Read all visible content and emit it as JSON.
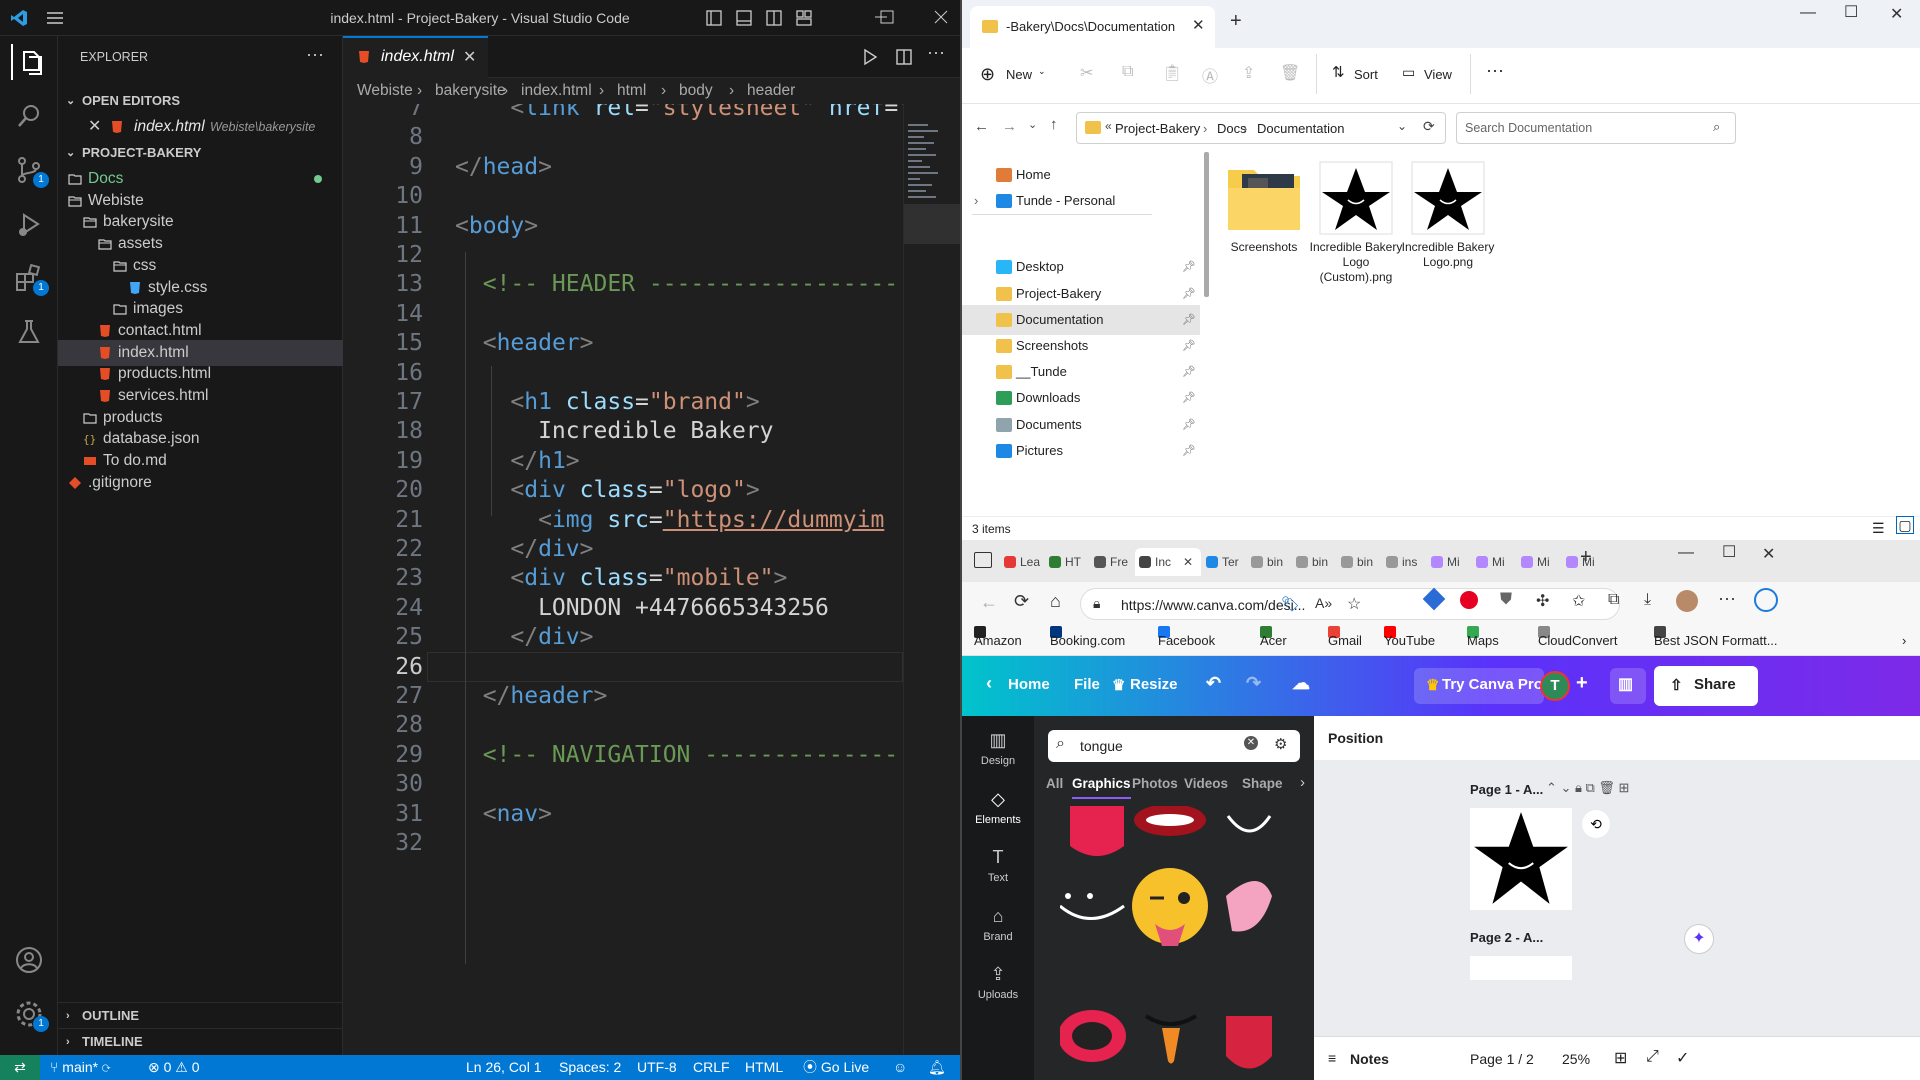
{
  "vscode": {
    "title": "index.html - Project-Bakery - Visual Studio Code",
    "explorer_label": "EXPLORER",
    "open_editors_label": "OPEN EDITORS",
    "open_editor_file": "index.html",
    "open_editor_path": "Webiste\\bakerysite",
    "project_label": "PROJECT-BAKERY",
    "tree": [
      {
        "label": "Docs",
        "kind": "folder",
        "depth": 0
      },
      {
        "label": "Webiste",
        "kind": "folder-open",
        "depth": 0
      },
      {
        "label": "bakerysite",
        "kind": "folder-open",
        "depth": 1
      },
      {
        "label": "assets",
        "kind": "folder-open",
        "depth": 2
      },
      {
        "label": "css",
        "kind": "folder-open",
        "depth": 3
      },
      {
        "label": "style.css",
        "kind": "css",
        "depth": 4
      },
      {
        "label": "images",
        "kind": "folder",
        "depth": 3
      },
      {
        "label": "contact.html",
        "kind": "html",
        "depth": 2
      },
      {
        "label": "index.html",
        "kind": "html",
        "depth": 2
      },
      {
        "label": "products.html",
        "kind": "html",
        "depth": 2
      },
      {
        "label": "services.html",
        "kind": "html",
        "depth": 2
      },
      {
        "label": "products",
        "kind": "folder",
        "depth": 1
      },
      {
        "label": "database.json",
        "kind": "json",
        "depth": 1
      },
      {
        "label": "To do.md",
        "kind": "md",
        "depth": 1
      },
      {
        "label": ".gitignore",
        "kind": "git",
        "depth": 0
      }
    ],
    "outline_label": "OUTLINE",
    "timeline_label": "TIMELINE",
    "tab_label": "index.html",
    "breadcrumb": [
      "Webiste",
      "bakerysite",
      "index.html",
      "html",
      "body",
      "header"
    ],
    "lines": [
      {
        "n": "7",
        "code": "    <link rel=\"stylesheet\" href=\""
      },
      {
        "n": "8",
        "code": ""
      },
      {
        "n": "9",
        "code": "</head>"
      },
      {
        "n": "10",
        "code": ""
      },
      {
        "n": "11",
        "code": "<body>"
      },
      {
        "n": "12",
        "code": ""
      },
      {
        "n": "13",
        "code": "  <!-- HEADER ------------------"
      },
      {
        "n": "14",
        "code": ""
      },
      {
        "n": "15",
        "code": "  <header>"
      },
      {
        "n": "16",
        "code": ""
      },
      {
        "n": "17",
        "code": "    <h1 class=\"brand\">"
      },
      {
        "n": "18",
        "code": "      Incredible Bakery"
      },
      {
        "n": "19",
        "code": "    </h1>"
      },
      {
        "n": "20",
        "code": "    <div class=\"logo\">"
      },
      {
        "n": "21",
        "code": "      <img src=\"https://dummyim"
      },
      {
        "n": "22",
        "code": "    </div>"
      },
      {
        "n": "23",
        "code": "    <div class=\"mobile\">"
      },
      {
        "n": "24",
        "code": "      LONDON +4476665343256"
      },
      {
        "n": "25",
        "code": "    </div>"
      },
      {
        "n": "26",
        "code": ""
      },
      {
        "n": "27",
        "code": "  </header>"
      },
      {
        "n": "28",
        "code": ""
      },
      {
        "n": "29",
        "code": "  <!-- NAVIGATION --------------"
      },
      {
        "n": "30",
        "code": ""
      },
      {
        "n": "31",
        "code": "  <nav>"
      },
      {
        "n": "32",
        "code": ""
      }
    ],
    "status": {
      "branch": "main*",
      "errors": "0",
      "warnings": "0",
      "cursor": "Ln 26, Col 1",
      "spaces": "Spaces: 2",
      "encoding": "UTF-8",
      "eol": "CRLF",
      "language": "HTML",
      "golive": "Go Live"
    },
    "badges": {
      "scm": "1",
      "extensions": "1",
      "settings": "1"
    },
    "colors": {
      "tag": "#569cd6",
      "attr": "#9cdcfe",
      "string": "#ce9178",
      "comment": "#6a9955",
      "text": "#d4d4d4",
      "accent": "#0078d4"
    }
  },
  "explorer": {
    "tab_title": "-Bakery\\Docs\\Documentation",
    "cmd": {
      "new": "New",
      "sort": "Sort",
      "view": "View"
    },
    "path": [
      "Project-Bakery",
      "Docs",
      "Documentation"
    ],
    "search_placeholder": "Search Documentation",
    "nav": [
      {
        "label": "Home",
        "pinned": false
      },
      {
        "label": "Tunde - Personal",
        "pinned": false
      },
      {
        "label": "Desktop",
        "pinned": true
      },
      {
        "label": "Project-Bakery",
        "pinned": true
      },
      {
        "label": "Documentation",
        "pinned": true
      },
      {
        "label": "Screenshots",
        "pinned": true
      },
      {
        "label": "__Tunde",
        "pinned": true
      },
      {
        "label": "Downloads",
        "pinned": true
      },
      {
        "label": "Documents",
        "pinned": true
      },
      {
        "label": "Pictures",
        "pinned": true
      }
    ],
    "files": [
      {
        "label": "Screenshots",
        "kind": "folder"
      },
      {
        "label": "Incredible Bakery Logo (Custom).png",
        "kind": "star"
      },
      {
        "label": "Incredible Bakery Logo.png",
        "kind": "star"
      }
    ],
    "status": "3 items"
  },
  "browser": {
    "tabs": [
      "Lea",
      "HT",
      "Fre",
      "Inc",
      "Ter",
      "bin",
      "bin",
      "bin",
      "ins",
      "Mi",
      "Mi",
      "Mi",
      "Mi"
    ],
    "url": "https://www.canva.com/desi...",
    "favorites": [
      "Amazon",
      "Booking.com",
      "Facebook",
      "Acer",
      "Gmail",
      "YouTube",
      "Maps",
      "CloudConvert",
      "Best JSON Formatt..."
    ],
    "canva": {
      "home": "Home",
      "file": "File",
      "resize": "Resize",
      "try_pro": "Try Canva Pro",
      "avatar": "T",
      "share": "Share",
      "rail": [
        "Design",
        "Elements",
        "Text",
        "Brand",
        "Uploads"
      ],
      "search_value": "tongue",
      "filters": [
        "All",
        "Graphics",
        "Photos",
        "Videos",
        "Shape"
      ],
      "position_label": "Position",
      "page1_label": "Page 1 - A...",
      "page2_label": "Page 2 - A...",
      "notes": "Notes",
      "page_count": "Page 1 / 2",
      "zoom": "25%"
    }
  }
}
